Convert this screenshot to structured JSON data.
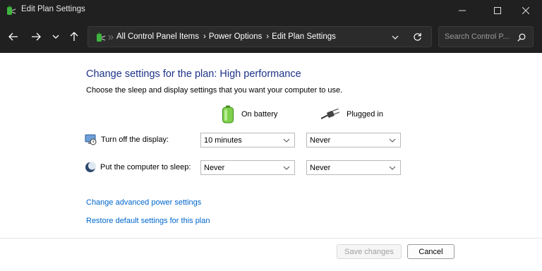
{
  "window": {
    "title": "Edit Plan Settings",
    "controls": [
      "minimize-icon",
      "maximize-icon",
      "close-icon"
    ]
  },
  "nav": {
    "breadcrumbs": [
      "All Control Panel Items",
      "Power Options",
      "Edit Plan Settings"
    ],
    "search_placeholder": "Search Control P..."
  },
  "main": {
    "heading": "Change settings for the plan: High performance",
    "subtext": "Choose the sleep and display settings that you want your computer to use.",
    "columns": {
      "battery": "On battery",
      "plugged": "Plugged in"
    },
    "rows": [
      {
        "label": "Turn off the display:",
        "battery": "10 minutes",
        "plugged": "Never"
      },
      {
        "label": "Put the computer to sleep:",
        "battery": "Never",
        "plugged": "Never"
      }
    ],
    "links": {
      "advanced": "Change advanced power settings",
      "restore": "Restore default settings for this plan"
    }
  },
  "footer": {
    "save": "Save changes",
    "cancel": "Cancel"
  },
  "colors": {
    "heading": "#1e3287",
    "link": "#0066cc",
    "chrome": "#202020"
  }
}
